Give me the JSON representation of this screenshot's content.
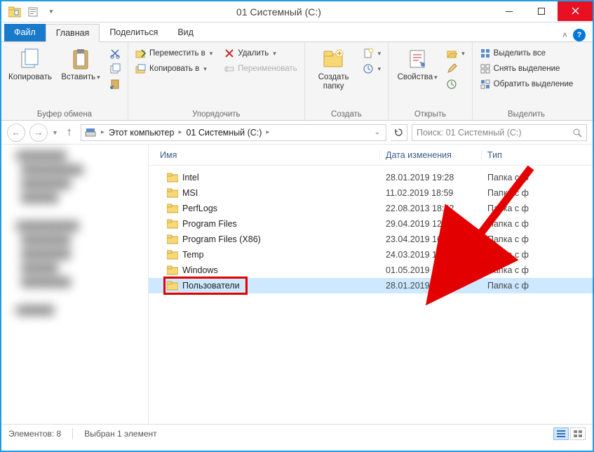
{
  "title": "01 Системный (C:)",
  "tabs": {
    "file": "Файл",
    "home": "Главная",
    "share": "Поделиться",
    "view": "Вид"
  },
  "ribbon": {
    "clipboard": {
      "copy": "Копировать",
      "paste": "Вставить",
      "label": "Буфер обмена"
    },
    "organize": {
      "move_to": "Переместить в",
      "copy_to": "Копировать в",
      "delete": "Удалить",
      "rename": "Переименовать",
      "label": "Упорядочить"
    },
    "new": {
      "new_folder": "Создать папку",
      "label": "Создать"
    },
    "open": {
      "properties": "Свойства",
      "label": "Открыть"
    },
    "select": {
      "select_all": "Выделить все",
      "select_none": "Снять выделение",
      "invert": "Обратить выделение",
      "label": "Выделить"
    }
  },
  "breadcrumb": {
    "root": "Этот компьютер",
    "current": "01 Системный (C:)"
  },
  "search_placeholder": "Поиск: 01 Системный (C:)",
  "columns": {
    "name": "Имя",
    "date": "Дата изменения",
    "type": "Тип"
  },
  "files": [
    {
      "name": "Intel",
      "date": "28.01.2019 19:28",
      "type": "Папка с ф"
    },
    {
      "name": "MSI",
      "date": "11.02.2019 18:59",
      "type": "Папка с ф"
    },
    {
      "name": "PerfLogs",
      "date": "22.08.2013 18:22",
      "type": "Папка с ф"
    },
    {
      "name": "Program Files",
      "date": "29.04.2019 12:57",
      "type": "Папка с ф"
    },
    {
      "name": "Program Files (X86)",
      "date": "23.04.2019 16:04",
      "type": "Папка с ф"
    },
    {
      "name": "Temp",
      "date": "24.03.2019 15:34",
      "type": "Папка с ф"
    },
    {
      "name": "Windows",
      "date": "01.05.2019 14:05",
      "type": "Папка с ф"
    },
    {
      "name": "Пользователи",
      "date": "28.01.2019 18:27",
      "type": "Папка с ф"
    }
  ],
  "selected_index": 7,
  "status": {
    "count_label": "Элементов: 8",
    "selected_label": "Выбран 1 элемент"
  }
}
